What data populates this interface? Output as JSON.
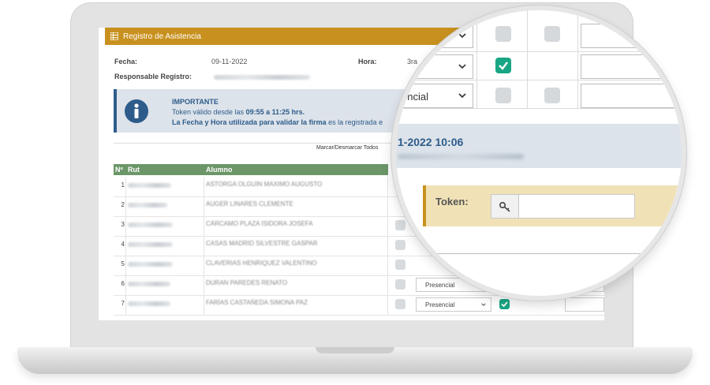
{
  "panel": {
    "title": "Registro de Asistencia"
  },
  "form": {
    "fecha_label": "Fecha:",
    "fecha_value": "09-11-2022",
    "hora_label": "Hora:",
    "hora_value": "3ra",
    "responsable_label": "Responsable Registro:"
  },
  "info": {
    "title": "IMPORTANTE",
    "line1_pre": "Token válido desde las ",
    "line1_time": "09:55 a 11:25 hrs.",
    "line2_bold": "La Fecha y Hora utilizada para validar la firma",
    "line2_rest": " es la registrada e"
  },
  "table": {
    "mark_all": "Marcar/Desmarcar Todos",
    "headers": {
      "num": "Nº",
      "rut": "Rut",
      "alumno": "Alumno"
    },
    "rows": [
      {
        "num": "1",
        "name": "ASTORGA OLGUIN MAXIMO AUGUSTO",
        "check": null,
        "select": "",
        "check2": null
      },
      {
        "num": "2",
        "name": "AUGER LINARES CLEMENTE",
        "check": null,
        "select": "",
        "check2": null
      },
      {
        "num": "3",
        "name": "CÁRCAMO PLAZA ISIDORA JOSEFA",
        "check": false,
        "select": "",
        "check2": null
      },
      {
        "num": "4",
        "name": "CASAS MADRID SILVESTRE GASPAR",
        "check": false,
        "select": "",
        "check2": null
      },
      {
        "num": "5",
        "name": "CLAVERIAS HENRIQUEZ VALENTINO",
        "check": false,
        "select": "",
        "check2": null
      },
      {
        "num": "6",
        "name": "DURAN PAREDES RENATO",
        "check": false,
        "select": "Presencial",
        "check2": null
      },
      {
        "num": "7",
        "name": "FARÍAS CASTAÑEDA SIMONA PAZ",
        "check": false,
        "select": "Presencial",
        "check2": true
      }
    ]
  },
  "magnifier": {
    "row2_select": "al",
    "row3_select": "encial",
    "date_text": "1-2022 10:06",
    "token_label": "Token:",
    "token_value": ""
  },
  "colors": {
    "header": "#c8911f",
    "info_bg": "#dde3ea",
    "info_text": "#2d5c8a",
    "table_header": "#6b9668",
    "check_on": "#19a685",
    "token_bg": "#f0e2b6"
  }
}
